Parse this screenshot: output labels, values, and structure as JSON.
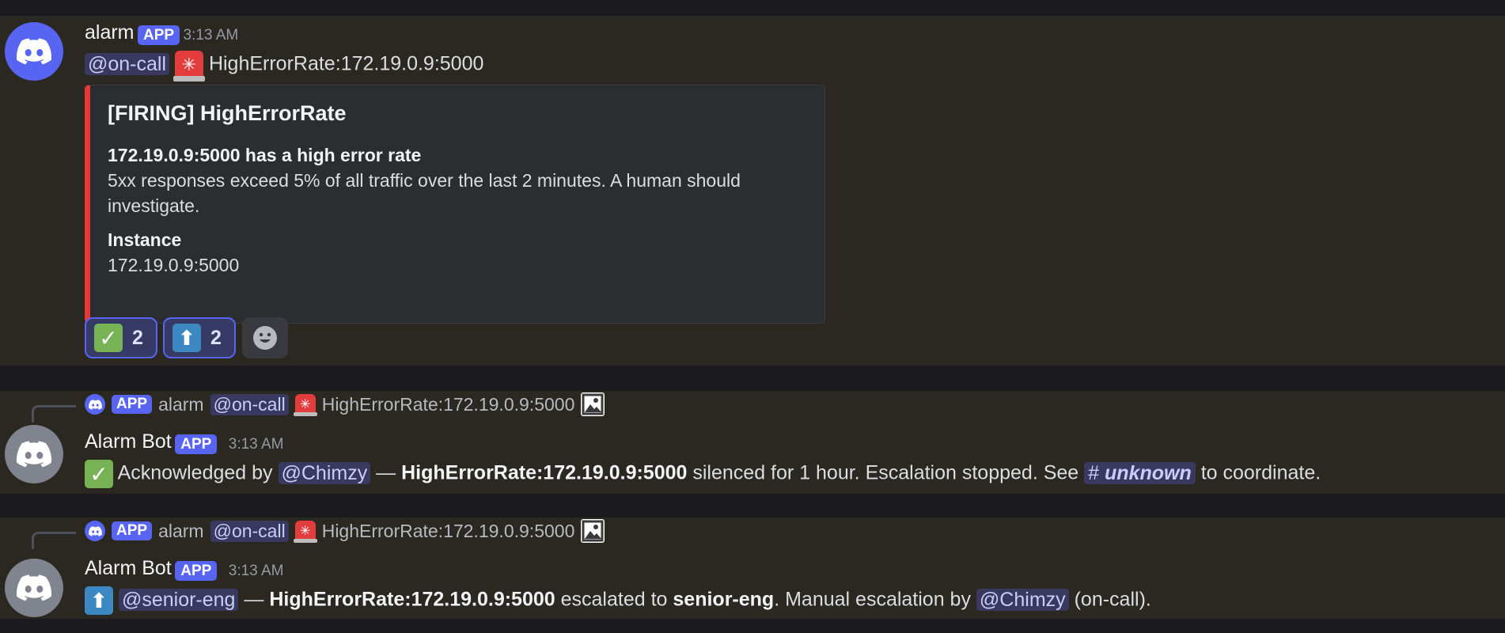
{
  "message1": {
    "author": "alarm",
    "app_tag": "APP",
    "time": "3:13 AM",
    "mention": "@on-call",
    "content": "HighErrorRate:172.19.0.9:5000",
    "embed": {
      "title": "[FIRING] HighErrorRate",
      "heading": "172.19.0.9:5000 has a high error rate",
      "description_1": "5xx responses exceed 5% of all traffic over the last 2 minutes. A human should",
      "description_2": "investigate.",
      "field_name": "Instance",
      "field_value": "172.19.0.9:5000",
      "accent_color": "#e53935"
    },
    "reactions": [
      {
        "emoji": "check-mark-icon",
        "count": "2"
      },
      {
        "emoji": "up-arrow-icon",
        "count": "2"
      }
    ]
  },
  "reply_preview": {
    "app_tag": "APP",
    "author": "alarm",
    "mention": "@on-call",
    "content": "HighErrorRate:172.19.0.9:5000"
  },
  "message2": {
    "author": "Alarm Bot",
    "app_tag": "APP",
    "time": "3:13 AM",
    "text_1": "Acknowledged by",
    "mention": "@Chimzy",
    "dash": "—",
    "bold": "HighErrorRate:172.19.0.9:5000",
    "text_2": "silenced for 1 hour. Escalation stopped. See",
    "channel_hash": "#",
    "channel": "unknown",
    "text_3": "to coordinate."
  },
  "message3": {
    "author": "Alarm Bot",
    "app_tag": "APP",
    "time": "3:13 AM",
    "mention": "@senior-eng",
    "dash": "—",
    "bold": "HighErrorRate:172.19.0.9:5000",
    "text_1": "escalated to",
    "bold_2": "senior-eng",
    "text_2": ". Manual escalation by",
    "mention_2": "@Chimzy",
    "text_3": "(on-call)."
  }
}
